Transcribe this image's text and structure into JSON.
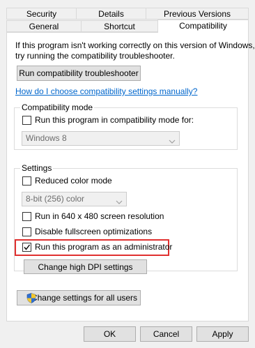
{
  "tabs_row1": [
    "Security",
    "Details",
    "Previous Versions"
  ],
  "tabs_row2": [
    "General",
    "Shortcut",
    "Compatibility"
  ],
  "intro_line1": "If this program isn't working correctly on this version of Windows,",
  "intro_line2": "try running the compatibility troubleshooter.",
  "troubleshooter_button": "Run compatibility troubleshooter",
  "manual_link": "How do I choose compatibility settings manually?",
  "compat_mode": {
    "legend": "Compatibility mode",
    "checkbox_label": "Run this program in compatibility mode for:",
    "checked": false,
    "selected_os": "Windows 8"
  },
  "settings": {
    "legend": "Settings",
    "reduced_color": {
      "label": "Reduced color mode",
      "checked": false
    },
    "color_option": "8-bit (256) color",
    "res_640": {
      "label": "Run in 640 x 480 screen resolution",
      "checked": false
    },
    "fullscreen_opt": {
      "label": "Disable fullscreen optimizations",
      "checked": false
    },
    "admin": {
      "label": "Run this program as an administrator",
      "checked": true
    },
    "dpi_button": "Change high DPI settings"
  },
  "all_users_button": "Change settings for all users",
  "footer": {
    "ok": "OK",
    "cancel": "Cancel",
    "apply": "Apply"
  },
  "highlight_color": "#e0302f"
}
